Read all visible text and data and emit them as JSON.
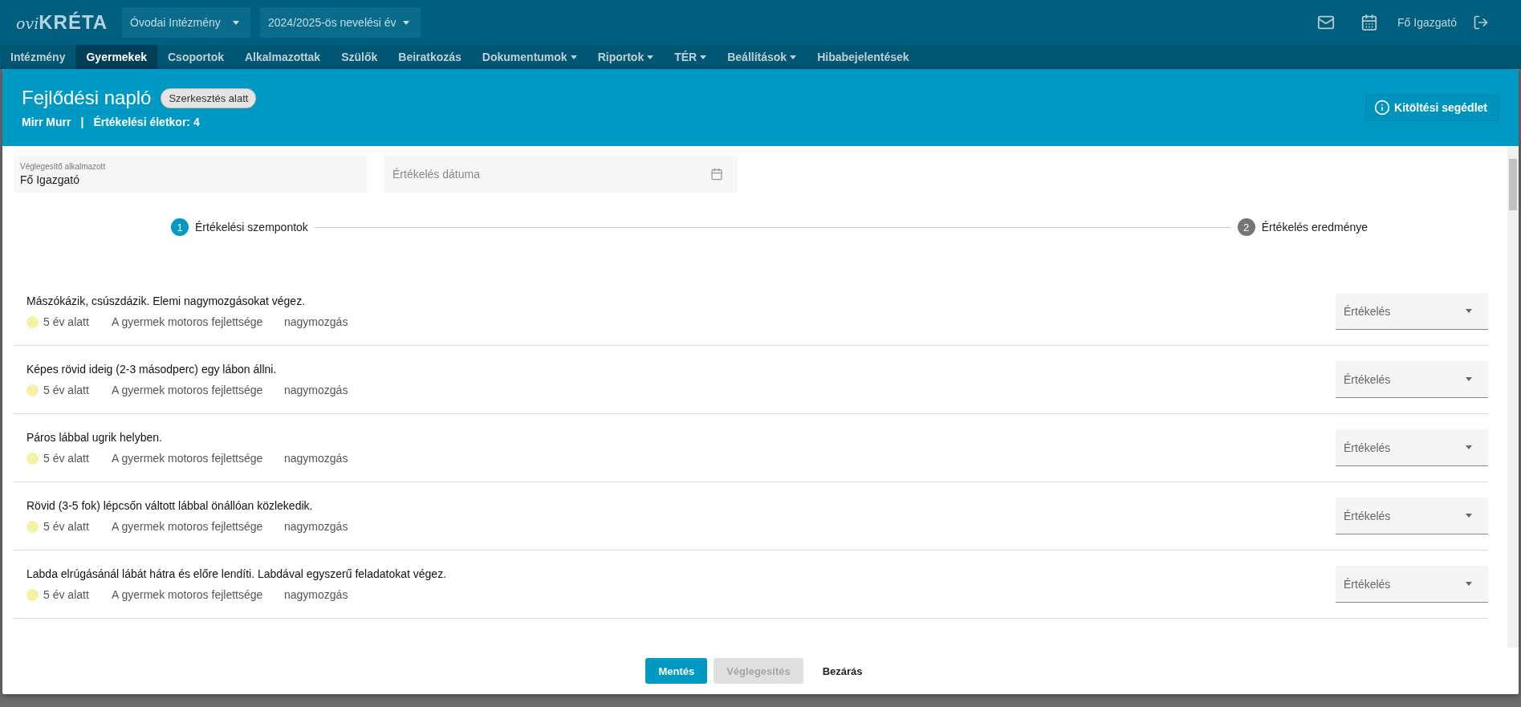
{
  "top_bar": {
    "logo_prefix": "ovi",
    "logo_name": "KRÉTA",
    "institution": "Óvodai Intézmény",
    "year": "2024/2025-ös nevelési év",
    "user": "Fő Igazgató"
  },
  "nav": [
    {
      "label": "Intézmény",
      "selected": false,
      "has_menu": false
    },
    {
      "label": "Gyermekek",
      "selected": true,
      "has_menu": false
    },
    {
      "label": "Csoportok",
      "selected": false,
      "has_menu": false
    },
    {
      "label": "Alkalmazottak",
      "selected": false,
      "has_menu": false
    },
    {
      "label": "Szülők",
      "selected": false,
      "has_menu": false
    },
    {
      "label": "Beiratkozás",
      "selected": false,
      "has_menu": false
    },
    {
      "label": "Dokumentumok",
      "selected": false,
      "has_menu": true
    },
    {
      "label": "Riportok",
      "selected": false,
      "has_menu": true
    },
    {
      "label": "TÉR",
      "selected": false,
      "has_menu": true
    },
    {
      "label": "Beállítások",
      "selected": false,
      "has_menu": true
    },
    {
      "label": "Hibabejelentések",
      "selected": false,
      "has_menu": false
    }
  ],
  "dialog": {
    "title": "Fejlődési napló",
    "status": "Szerkesztés alatt",
    "student": "Mirr Murr",
    "separator": "|",
    "age": "Értékelési életkor: 4",
    "help_button": "Kitöltési segédlet",
    "fields": [
      {
        "label": "Véglegesítő alkalmazott",
        "value": "Fő Igazgató"
      },
      {
        "placeholder": "Értékelés dátuma"
      }
    ],
    "steps": [
      {
        "number": "1",
        "label": "Értékelési szempontok",
        "selected": true
      },
      {
        "number": "2",
        "label": "Értékelés eredménye",
        "selected": false
      }
    ],
    "criteria": [
      {
        "text": "Mászókázik, csúszdázik. Elemi nagymozgásokat végez.",
        "age_group": "5 év alatt",
        "color": "#f5f3a3",
        "area": "A gyermek motoros fejlettsége",
        "subarea": "nagymozgás",
        "select_placeholder": "Értékelés"
      },
      {
        "text": "Képes rövid ideig (2-3 másodperc) egy lábon állni.",
        "age_group": "5 év alatt",
        "color": "#f5f3a3",
        "area": "A gyermek motoros fejlettsége",
        "subarea": "nagymozgás",
        "select_placeholder": "Értékelés"
      },
      {
        "text": "Páros lábbal ugrik helyben.",
        "age_group": "5 év alatt",
        "color": "#f5f3a3",
        "area": "A gyermek motoros fejlettsége",
        "subarea": "nagymozgás",
        "select_placeholder": "Értékelés"
      },
      {
        "text": "Rövid (3-5 fok) lépcsőn váltott lábbal önállóan közlekedik.",
        "age_group": "5 év alatt",
        "color": "#f5f3a3",
        "area": "A gyermek motoros fejlettsége",
        "subarea": "nagymozgás",
        "select_placeholder": "Értékelés"
      },
      {
        "text": "Labda elrúgásánál lábát hátra és előre lendíti. Labdával egyszerű feladatokat végez.",
        "age_group": "5 év alatt",
        "color": "#f5f3a3",
        "area": "A gyermek motoros fejlettsége",
        "subarea": "nagymozgás",
        "select_placeholder": "Értékelés"
      }
    ],
    "buttons": [
      {
        "label": "Mentés",
        "kind": "primary",
        "disabled": false
      },
      {
        "label": "Véglegesítés",
        "kind": "primary",
        "disabled": true
      },
      {
        "label": "Bezárás",
        "kind": "text",
        "disabled": false
      }
    ]
  }
}
